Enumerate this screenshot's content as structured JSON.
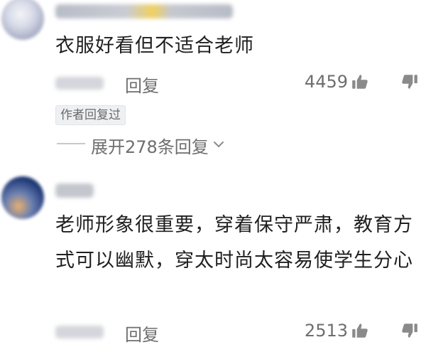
{
  "comments": [
    {
      "text": "衣服好看但不适合老师",
      "reply_label": "回复",
      "likes": "4459",
      "author_badge": "作者回复过",
      "expand_label": "展开278条回复"
    },
    {
      "text": "老师形象很重要，穿着保守严肃，教育方式可以幽默，穿太时尚太容易使学生分心",
      "reply_label": "回复",
      "likes": "2513"
    }
  ],
  "icons": {
    "like": "thumbs-up-icon",
    "dislike": "thumbs-down-icon",
    "expand": "chevron-down-icon"
  },
  "colors": {
    "text_primary": "#1f1f1f",
    "text_secondary": "#6e6e6e",
    "icon": "#8a8a8a"
  }
}
